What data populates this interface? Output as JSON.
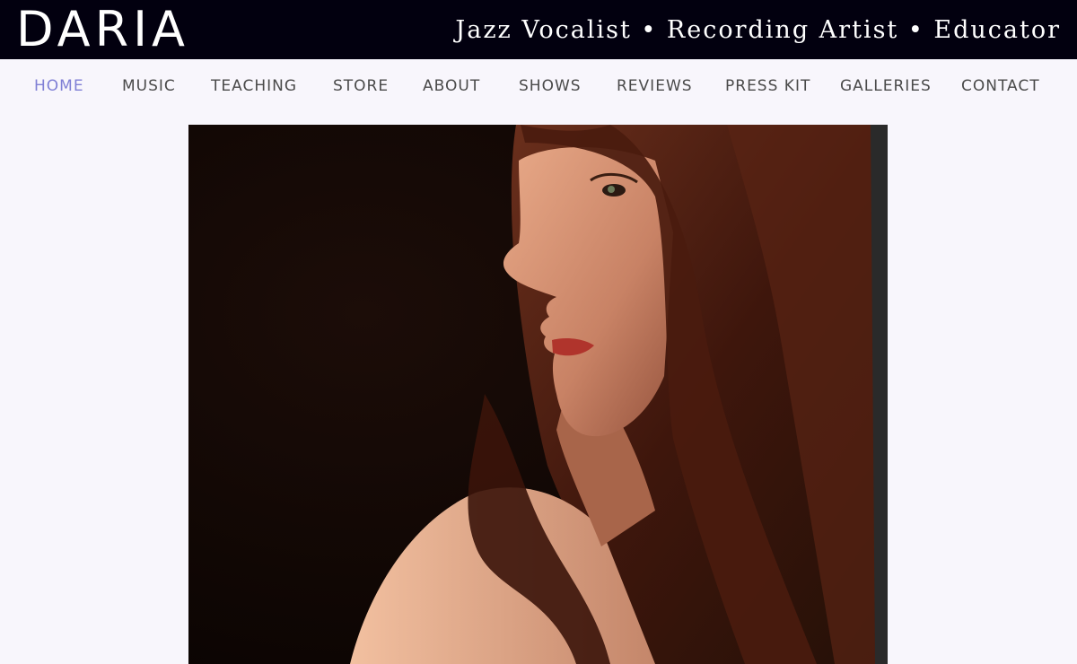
{
  "header": {
    "logo_text": "DARIA",
    "tagline": "Jazz Vocalist • Recording Artist • Educator"
  },
  "nav": {
    "active_color": "#7f7fd5",
    "items": [
      {
        "label": "HOME",
        "active": true
      },
      {
        "label": "MUSIC"
      },
      {
        "label": "TEACHING"
      },
      {
        "label": "STORE"
      },
      {
        "label": "ABOUT"
      },
      {
        "label": "SHOWS"
      },
      {
        "label": "REVIEWS"
      },
      {
        "label": "PRESS KIT"
      },
      {
        "label": "GALLERIES"
      },
      {
        "label": "CONTACT"
      }
    ]
  },
  "hero": {
    "image_subject": "portrait-photo"
  },
  "colors": {
    "header_bg": "#02000f",
    "page_bg": "#f8f6fc",
    "nav_text": "#4a4a4a"
  }
}
